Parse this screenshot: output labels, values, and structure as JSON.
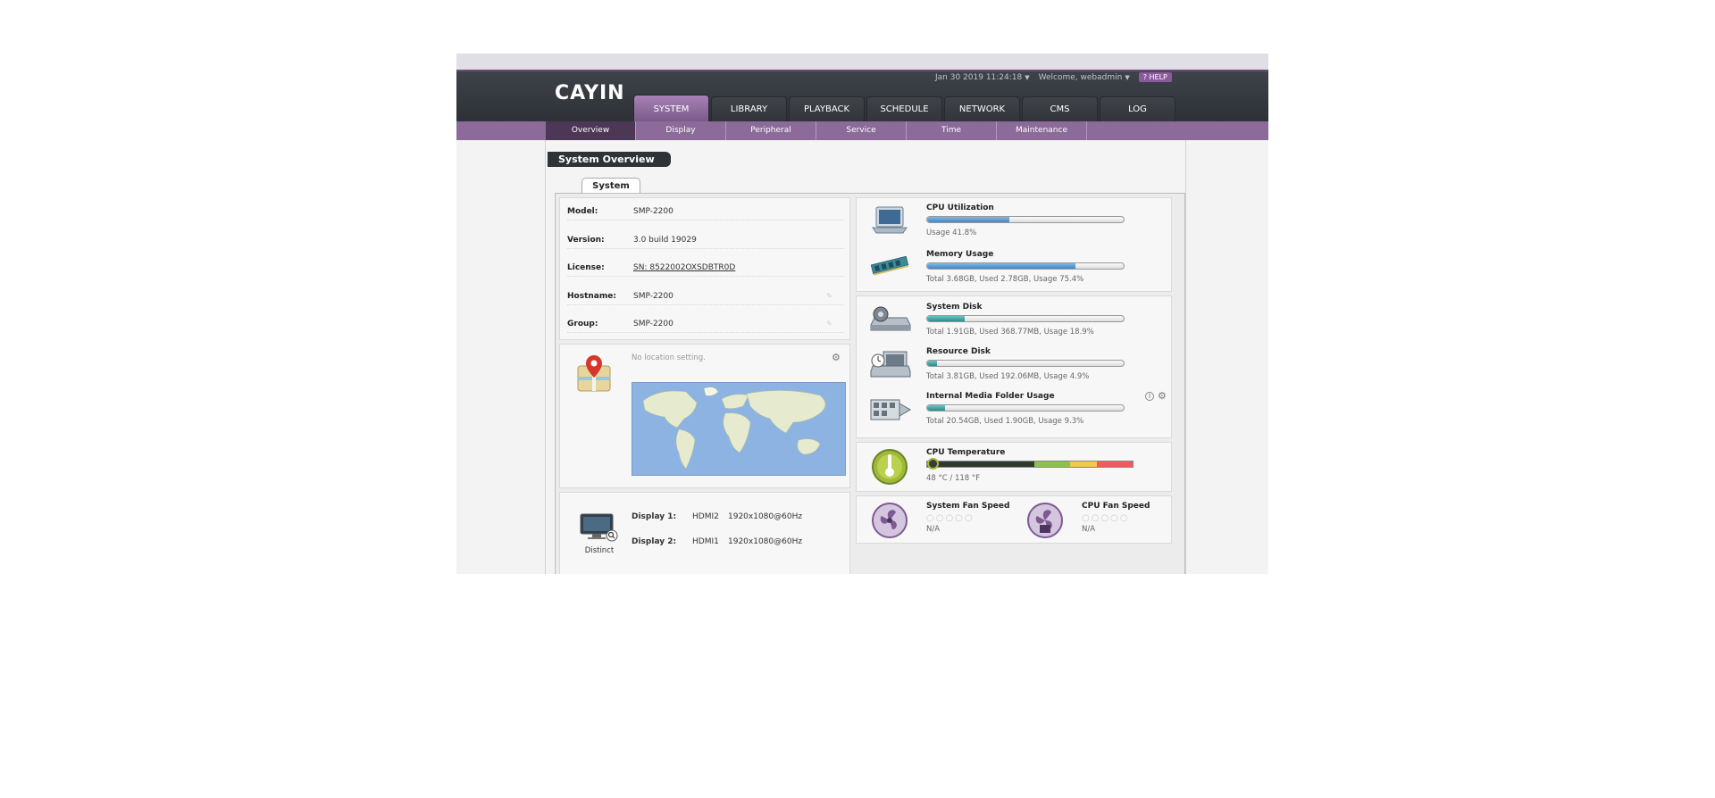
{
  "header": {
    "logo": "CAYIN",
    "datetime": "Jan 30 2019 11:24:18",
    "welcome": "Welcome, webadmin",
    "help_label": "HELP",
    "tabs": [
      {
        "label": "SYSTEM",
        "active": true
      },
      {
        "label": "LIBRARY",
        "active": false
      },
      {
        "label": "PLAYBACK",
        "active": false
      },
      {
        "label": "SCHEDULE",
        "active": false
      },
      {
        "label": "NETWORK",
        "active": false
      },
      {
        "label": "CMS",
        "active": false
      },
      {
        "label": "LOG",
        "active": false
      }
    ]
  },
  "subnav": [
    "Overview",
    "Display",
    "Peripheral",
    "Service",
    "Time",
    "Maintenance"
  ],
  "page": {
    "title": "System Overview",
    "inner_tab": "System"
  },
  "info": {
    "model_label": "Model:",
    "model": "SMP-2200",
    "version_label": "Version:",
    "version": "3.0 build 19029",
    "license_label": "License:",
    "license": "SN: 8522002OXSDBTR0D",
    "hostname_label": "Hostname:",
    "hostname": "SMP-2200",
    "group_label": "Group:",
    "group": "SMP-2200"
  },
  "location": {
    "text": "No location setting."
  },
  "displays": {
    "mode": "Distinct",
    "d1_label": "Display 1:",
    "d1_port": "HDMI2",
    "d1_res": "1920x1080@60Hz",
    "d2_label": "Display 2:",
    "d2_port": "HDMI1",
    "d2_res": "1920x1080@60Hz"
  },
  "stats": {
    "cpu": {
      "title": "CPU Utilization",
      "text": "Usage 41.8%",
      "percent": 41.8
    },
    "memory": {
      "title": "Memory Usage",
      "text": "Total 3.68GB, Used 2.78GB, Usage 75.4%",
      "percent": 75.4
    },
    "sysdisk": {
      "title": "System Disk",
      "text": "Total 1.91GB, Used 368.77MB, Usage 18.9%",
      "percent": 18.9
    },
    "resdisk": {
      "title": "Resource Disk",
      "text": "Total 3.81GB, Used 192.06MB, Usage 4.9%",
      "percent": 4.9
    },
    "media": {
      "title": "Internal Media Folder Usage",
      "text": "Total 20.54GB, Used 1.90GB, Usage 9.3%",
      "percent": 9.3
    },
    "temp": {
      "title": "CPU Temperature",
      "text": "48 °C / 118 °F",
      "celsius": 48
    },
    "sysfan": {
      "title": "System Fan Speed",
      "text": "N/A"
    },
    "cpufan": {
      "title": "CPU Fan Speed",
      "text": "N/A"
    }
  },
  "colors": {
    "accent": "#8c6a9a",
    "header": "#33373c",
    "bar_blue": "#3e87c7",
    "bar_teal": "#2a8b8e"
  }
}
